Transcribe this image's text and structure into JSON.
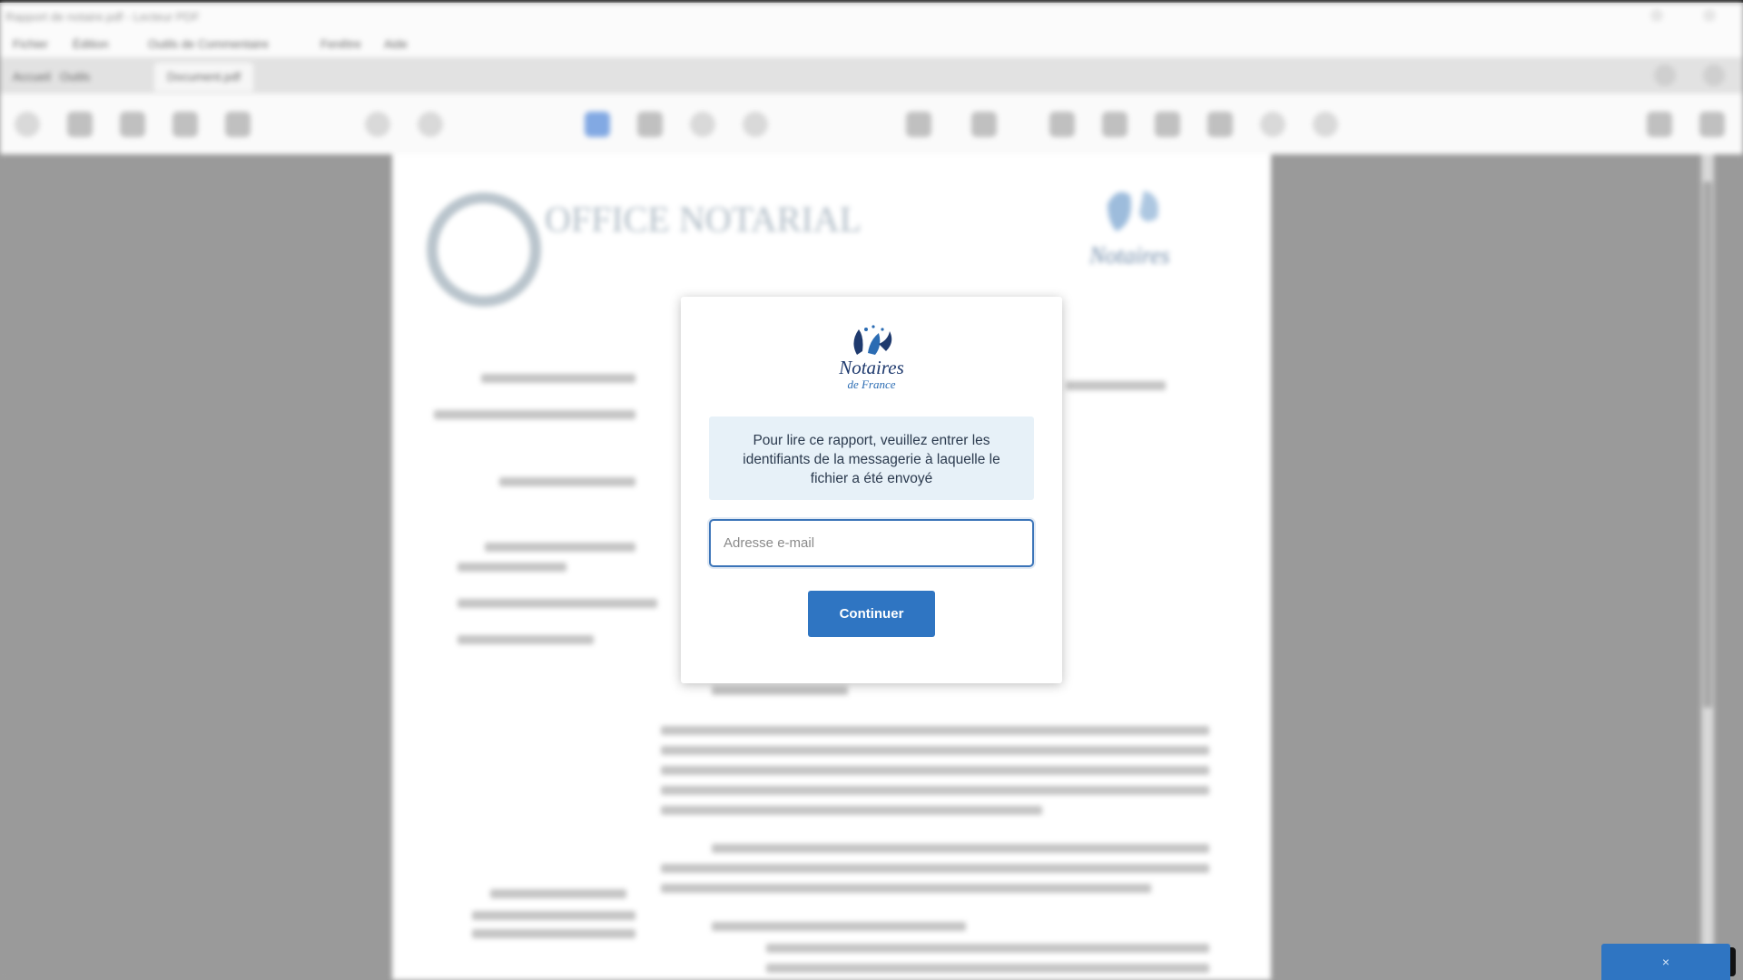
{
  "background": {
    "window_title": "Rapport de notaire.pdf - Lecteur PDF",
    "menu": [
      "Fichier",
      "Édition",
      "Outils de Commentaire",
      "Fenêtre",
      "Aide"
    ],
    "tabs": [
      "Accueil",
      "Outils",
      "Document.pdf"
    ],
    "document": {
      "logo_left_text": "OFFICE NOTARIAL",
      "logo_right_text": "Notaires"
    }
  },
  "modal": {
    "logo": {
      "name": "Notaires",
      "subtitle": "de France",
      "accent": "#2b6cb3"
    },
    "info_text": "Pour lire ce rapport, veuillez entrer les identifiants de la messagerie à laquelle le fichier a été envoyé",
    "email": {
      "value": "",
      "placeholder": "Adresse e-mail"
    },
    "submit_label": "Continuer"
  },
  "notification": {
    "close_label": "×"
  },
  "colors": {
    "primary": "#2f75c2",
    "info_bg": "#e7f1f8",
    "backdrop": "#9a9a9a"
  }
}
